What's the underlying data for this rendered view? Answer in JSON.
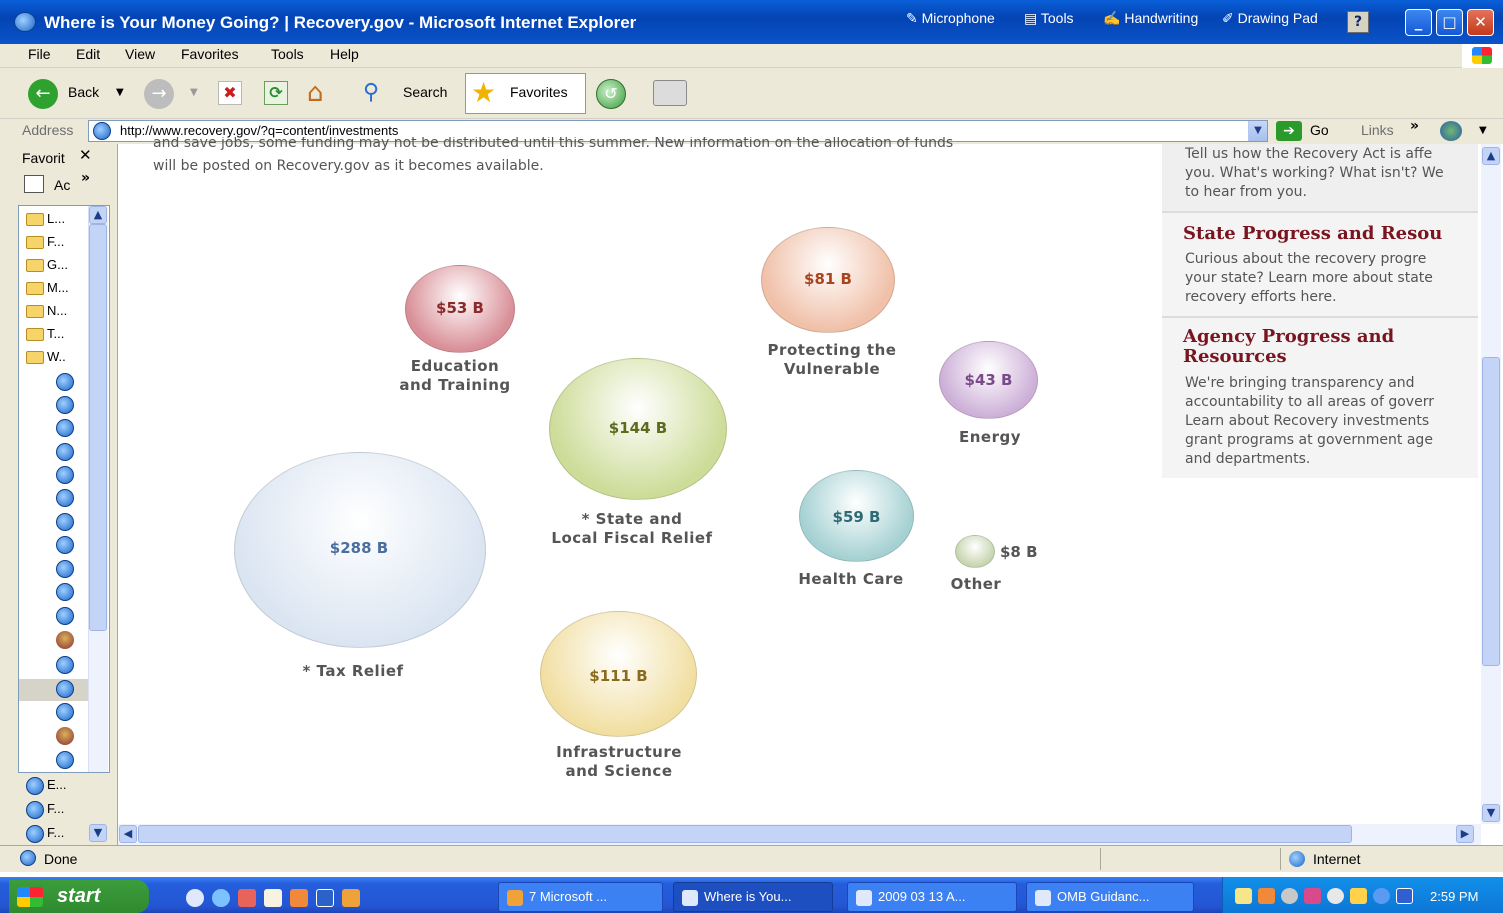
{
  "window": {
    "title": "Where is Your Money Going? | Recovery.gov - Microsoft Internet Explorer",
    "language_bar": [
      "Microphone",
      "Tools",
      "Handwriting",
      "Drawing Pad"
    ],
    "help": "?"
  },
  "menu": [
    "File",
    "Edit",
    "View",
    "Favorites",
    "Tools",
    "Help"
  ],
  "toolbar": {
    "back": "Back",
    "search": "Search",
    "favorites": "Favorites"
  },
  "address": {
    "label": "Address",
    "url": "http://www.recovery.gov/?q=content/investments",
    "go": "Go",
    "links": "Links"
  },
  "sidebar": {
    "title": "Favorit",
    "sub": "Ac",
    "folders": [
      "L...",
      "F...",
      "G...",
      "M...",
      "N...",
      "T...",
      "W.."
    ],
    "bottom_items": [
      "E...",
      "F...",
      "F..."
    ]
  },
  "page": {
    "intro_cut": "and save jobs, some funding may not be distributed until this summer. New information on the allocation of funds",
    "intro": "will be posted on Recovery.gov as it becomes available.",
    "bubbles": [
      {
        "value": "$53 B",
        "label1": "Education",
        "label2": "and Training",
        "color": "#d98f97"
      },
      {
        "value": "$81 B",
        "label1": "Protecting the",
        "label2": "Vulnerable",
        "color": "#f0c0a8"
      },
      {
        "value": "$43 B",
        "label1": "Energy",
        "label2": "",
        "color": "#cdb0d8"
      },
      {
        "value": "$144 B",
        "label1": "* State and",
        "label2": "Local Fiscal Relief",
        "color": "#cddc98"
      },
      {
        "value": "$288 B",
        "label1": "* Tax Relief",
        "label2": "",
        "color": "#dbe5f2"
      },
      {
        "value": "$59 B",
        "label1": "Health Care",
        "label2": "",
        "color": "#a5d1d3"
      },
      {
        "value": "$8 B",
        "label1": "Other",
        "label2": "",
        "color": "#c7d5b0"
      },
      {
        "value": "$111 B",
        "label1": "Infrastructure",
        "label2": "and Science",
        "color": "#f1dfa2"
      }
    ],
    "panel": {
      "feedback_lines": [
        "Tell us how the Recovery Act is affe",
        "you. What's working? What isn't? We",
        "to hear from you."
      ],
      "state_title": "State Progress and Resou",
      "state_lines": [
        "Curious about the recovery progre",
        "your state? Learn more about state",
        "recovery efforts here."
      ],
      "agency_title_1": "Agency Progress and",
      "agency_title_2": "Resources",
      "agency_lines": [
        "We're bringing transparency and",
        "accountability to all areas of goverr",
        "Learn about Recovery investments",
        "grant programs at government age",
        "and departments."
      ]
    }
  },
  "status": {
    "left": "Done",
    "zone": "Internet"
  },
  "taskbar": {
    "start": "start",
    "tasks": [
      "7 Microsoft ...",
      "Where is You...",
      "2009 03 13 A...",
      "OMB Guidanc..."
    ],
    "clock": "2:59 PM"
  }
}
